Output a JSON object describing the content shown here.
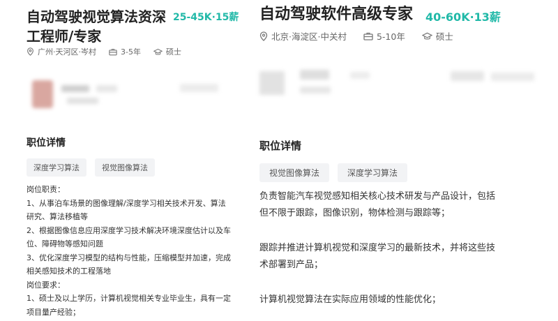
{
  "left": {
    "title_line1": "自动驾驶视觉算法资深",
    "title_line2": "工程师/专家",
    "salary": "25-45K·15薪",
    "location": "广州·天河区·岑村",
    "experience": "3-5年",
    "education": "硕士",
    "section_title": "职位详情",
    "tags": [
      "深度学习算法",
      "视觉图像算法"
    ],
    "description": [
      "岗位职责：",
      "1、从事泊车场景的图像理解/深度学习相关技术开发、算法",
      "研究、算法移植等",
      "2、根据图像信息应用深度学习技术解决环境深度估计以及车",
      "位、障碍物等感知问题",
      "3、优化深度学习模型的结构与性能，压缩模型并加速，完成",
      "相关感知技术的工程落地",
      "岗位要求：",
      "1、硕士及以上学历，计算机视觉相关专业毕业生，具有一定",
      "项目量产经验；"
    ]
  },
  "right": {
    "title": "自动驾驶软件高级专家",
    "salary": "40-60K·13薪",
    "location": "北京·海淀区·中关村",
    "experience": "5-10年",
    "education": "硕士",
    "section_title": "职位详情",
    "tags": [
      "视觉图像算法",
      "深度学习算法"
    ],
    "description": [
      "负责智能汽车视觉感知相关核心技术研发与产品设计，包括",
      "但不限于跟踪，图像识别，物体检测与跟踪等；",
      "",
      "跟踪并推进计算机视觉和深度学习的最新技术，并将这些技",
      "术部署到产品；",
      "",
      "计算机视觉算法在实际应用领域的性能优化；"
    ]
  },
  "colors": {
    "salary": "#21b9a8",
    "tag_bg": "#f2f3f5"
  },
  "icons": {
    "location": "location-pin-icon",
    "experience": "briefcase-icon",
    "education": "graduation-cap-icon"
  }
}
